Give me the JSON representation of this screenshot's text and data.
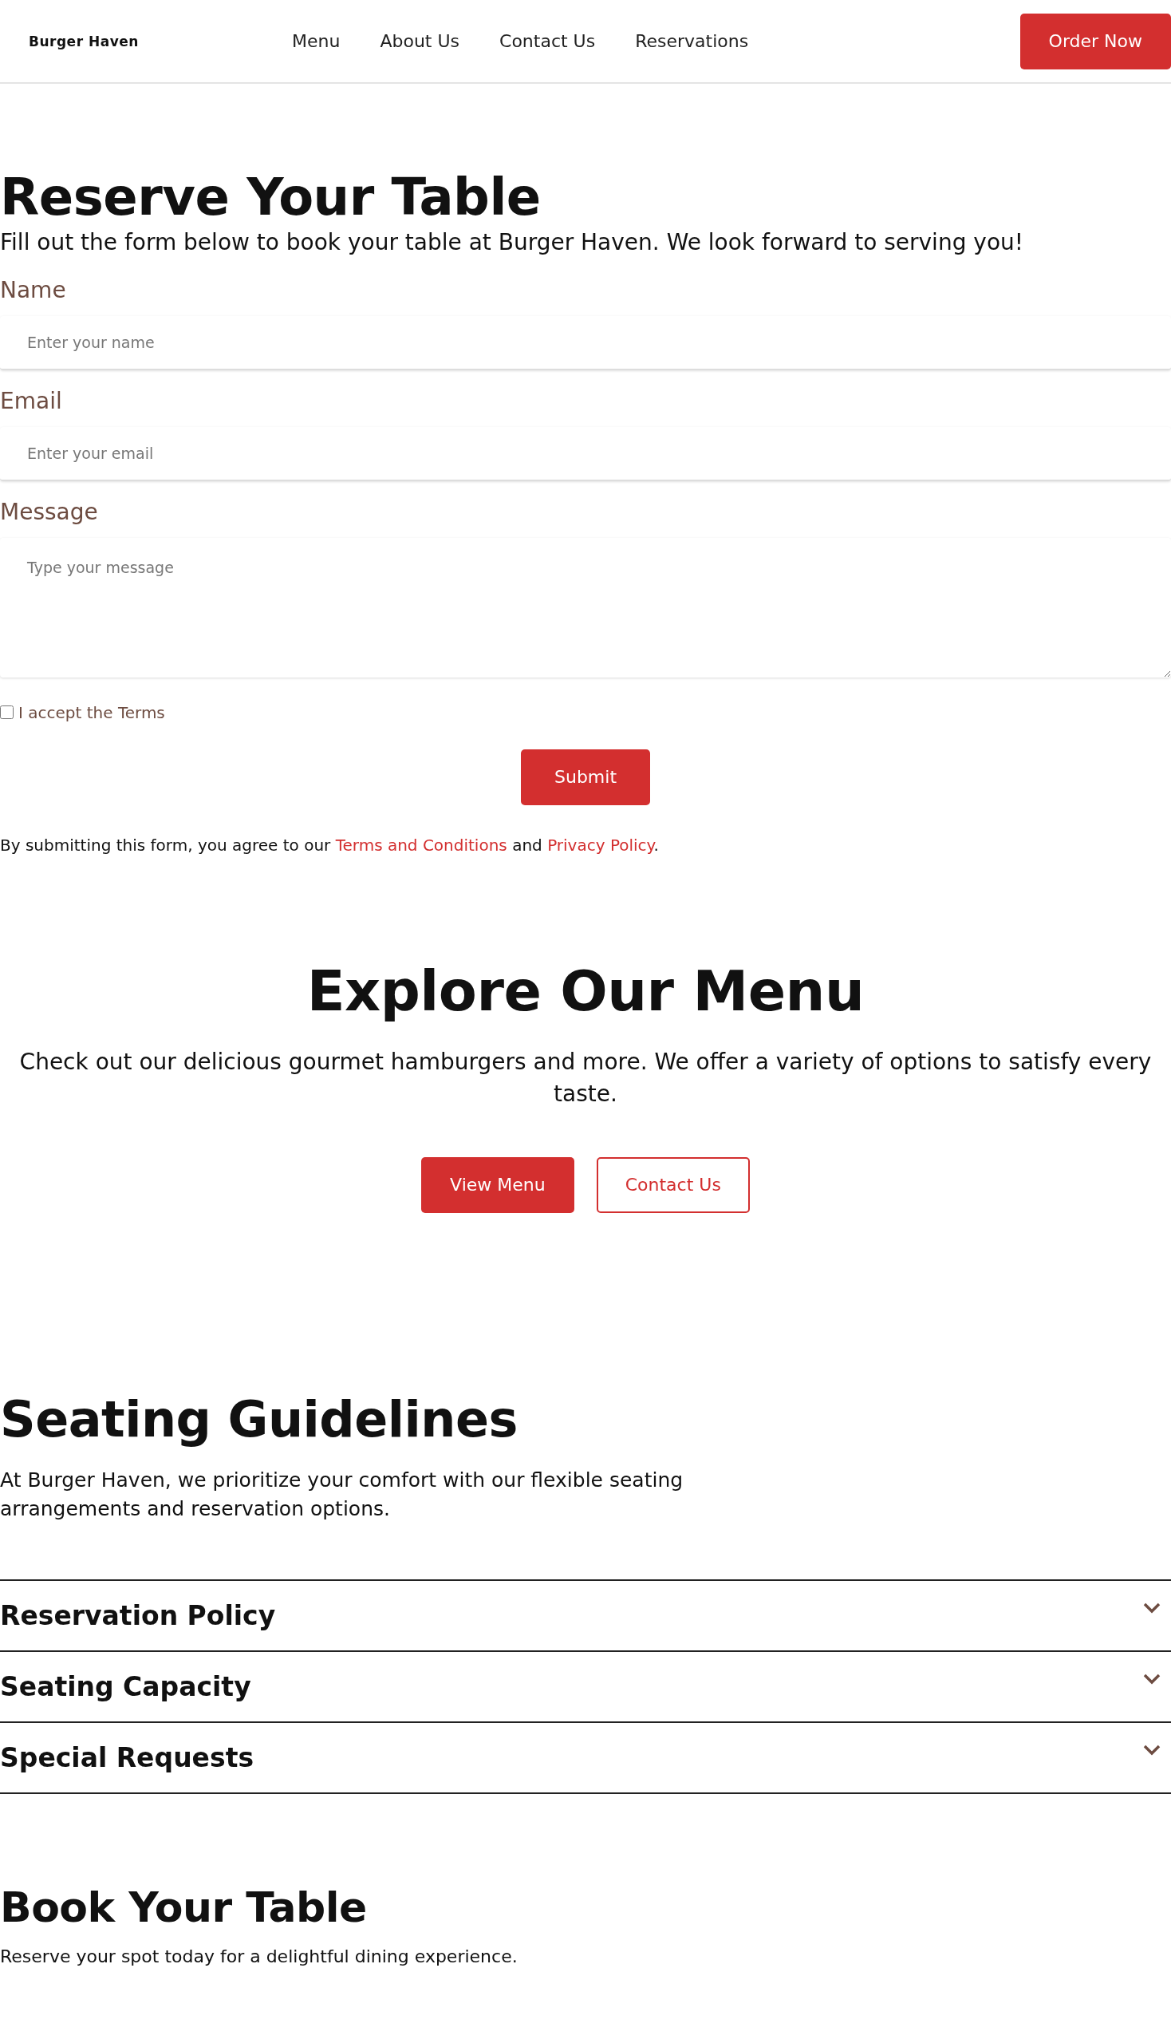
{
  "header": {
    "logo": "Burger Haven",
    "nav": [
      {
        "label": "Menu"
      },
      {
        "label": "About Us"
      },
      {
        "label": "Contact Us"
      },
      {
        "label": "Reservations"
      }
    ],
    "cta": "Order Now"
  },
  "reserve": {
    "title": "Reserve Your Table",
    "subtitle": "Fill out the form below to book your table at Burger Haven. We look forward to serving you!",
    "fields": [
      {
        "kind": "input",
        "label": "Name",
        "placeholder": "Enter your name"
      },
      {
        "kind": "input",
        "label": "Email",
        "placeholder": "Enter your email"
      },
      {
        "kind": "textarea",
        "label": "Message",
        "placeholder": "Type your message"
      }
    ],
    "terms_checkbox": {
      "label": "I accept the Terms",
      "checked": false
    },
    "submit": "Submit",
    "notice": {
      "before": "By submitting this form, you agree to our",
      "link_1": "Terms and Conditions",
      "middle": "and",
      "link_2": "Privacy Policy",
      "after": "."
    }
  },
  "explore": {
    "title": "Explore Our Menu",
    "text": "Check out our delicious gourmet hamburgers and more. We offer a variety of options to satisfy every taste.",
    "buttons": [
      {
        "label": "View Menu",
        "kind": "primary"
      },
      {
        "label": "Contact Us",
        "kind": "outline"
      }
    ]
  },
  "seating": {
    "title": "Seating Guidelines",
    "text": "At Burger Haven, we prioritize your comfort with our flexible seating arrangements and reservation options.",
    "accordion": [
      {
        "title": "Reservation Policy",
        "expanded": false
      },
      {
        "title": "Seating Capacity",
        "expanded": false
      },
      {
        "title": "Special Requests",
        "expanded": false
      }
    ]
  },
  "book": {
    "title": "Book Your Table",
    "text": "Reserve your spot today for a delightful dining experience."
  }
}
